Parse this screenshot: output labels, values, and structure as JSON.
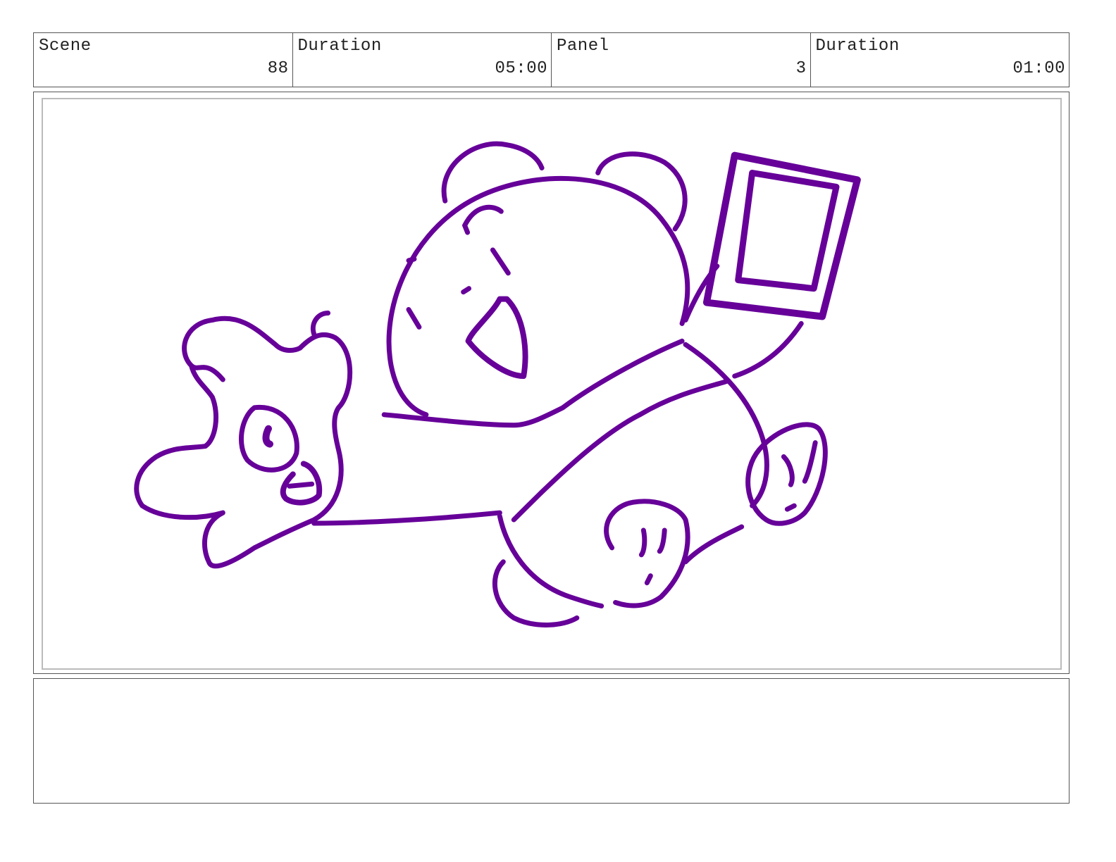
{
  "header": {
    "scene_label": "Scene",
    "scene_value": "88",
    "scene_duration_label": "Duration",
    "scene_duration_value": "05:00",
    "panel_label": "Panel",
    "panel_value": "3",
    "panel_duration_label": "Duration",
    "panel_duration_value": "01:00"
  },
  "drawing": {
    "subject": "bear-sketch",
    "line_color": "#660099"
  },
  "notes": {
    "text": ""
  }
}
